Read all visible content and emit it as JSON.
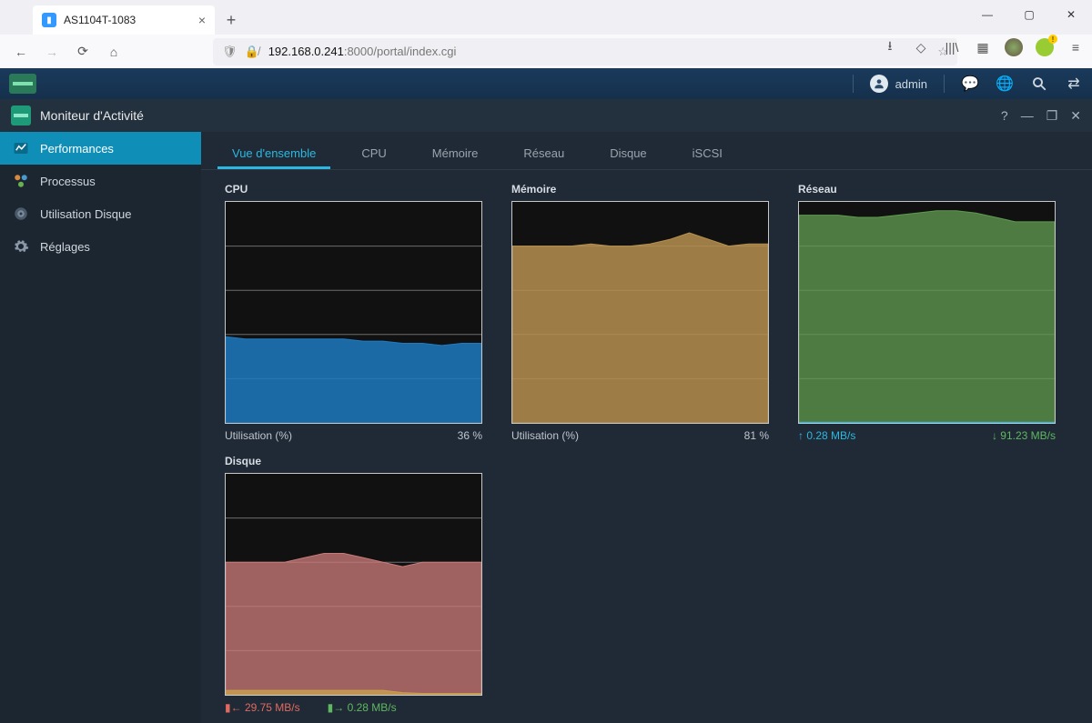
{
  "browser": {
    "tab_title": "AS1104T-1083",
    "url_host": "192.168.0.241",
    "url_path": ":8000/portal/index.cgi"
  },
  "app_topbar": {
    "username": "admin"
  },
  "window": {
    "title": "Moniteur d'Activité"
  },
  "sidebar": {
    "items": [
      {
        "label": "Performances",
        "icon": "chart-icon"
      },
      {
        "label": "Processus",
        "icon": "process-icon"
      },
      {
        "label": "Utilisation Disque",
        "icon": "disk-icon"
      },
      {
        "label": "Réglages",
        "icon": "gear-icon"
      }
    ]
  },
  "tabs": [
    "Vue d'ensemble",
    "CPU",
    "Mémoire",
    "Réseau",
    "Disque",
    "iSCSI"
  ],
  "panels": {
    "cpu": {
      "title": "CPU",
      "footer_left": "Utilisation (%)",
      "footer_right": "36 %"
    },
    "memory": {
      "title": "Mémoire",
      "footer_left": "Utilisation (%)",
      "footer_right": "81 %"
    },
    "network": {
      "title": "Réseau",
      "up": "0.28 MB/s",
      "down": "91.23 MB/s"
    },
    "disk": {
      "title": "Disque",
      "read": "29.75 MB/s",
      "write": "0.28 MB/s"
    }
  },
  "chart_data": [
    {
      "type": "area",
      "title": "CPU",
      "xlabel": "",
      "ylabel": "Utilisation (%)",
      "ylim": [
        0,
        100
      ],
      "color": "#1f7ac0",
      "values": [
        39,
        38,
        38,
        38,
        38,
        38,
        38,
        37,
        37,
        36,
        36,
        35,
        36,
        36
      ]
    },
    {
      "type": "area",
      "title": "Mémoire",
      "xlabel": "",
      "ylabel": "Utilisation (%)",
      "ylim": [
        0,
        100
      ],
      "color": "#b6914f",
      "values": [
        80,
        80,
        80,
        80,
        81,
        80,
        80,
        81,
        83,
        86,
        83,
        80,
        81,
        81
      ]
    },
    {
      "type": "area",
      "title": "Réseau",
      "xlabel": "",
      "ylabel": "MB/s",
      "ylim": [
        0,
        100
      ],
      "series": [
        {
          "name": "down",
          "color": "#5f9a4f",
          "values": [
            94,
            94,
            94,
            93,
            93,
            94,
            95,
            96,
            96,
            95,
            93,
            91,
            91,
            91
          ]
        },
        {
          "name": "up",
          "color": "#2bb8e0",
          "values": [
            0.3,
            0.3,
            0.28,
            0.28,
            0.28,
            0.28,
            0.28,
            0.28,
            0.28,
            0.28,
            0.28,
            0.28,
            0.28,
            0.28
          ]
        }
      ]
    },
    {
      "type": "area",
      "title": "Disque",
      "xlabel": "",
      "ylabel": "MB/s",
      "ylim": [
        0,
        50
      ],
      "series": [
        {
          "name": "read",
          "color": "#c87a78",
          "values": [
            30,
            30,
            30,
            30,
            31,
            32,
            32,
            31,
            30,
            29,
            30,
            30,
            30,
            30
          ]
        },
        {
          "name": "write",
          "color": "#c9a050",
          "values": [
            1,
            1,
            1,
            1,
            1,
            1,
            1,
            1,
            1,
            0.5,
            0.3,
            0.3,
            0.3,
            0.3
          ]
        }
      ]
    }
  ]
}
